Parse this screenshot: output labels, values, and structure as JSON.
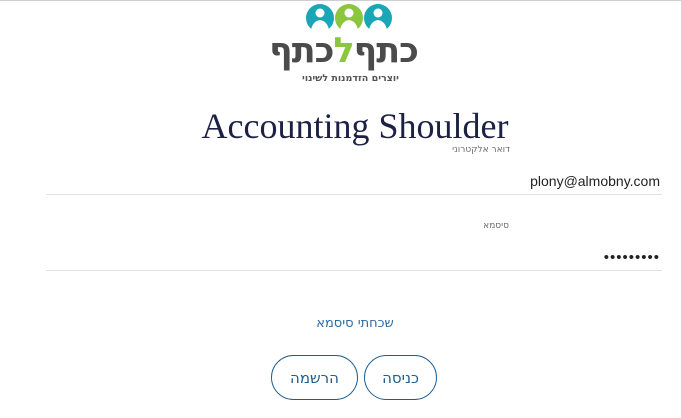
{
  "brand": {
    "logo_text_dark_right": "כתף",
    "logo_text_green": "ל",
    "logo_text_dark_left": "כתף",
    "tagline": "יוצרים הזדמנות לשינוי",
    "colors": {
      "green": "#8cc63f",
      "teal": "#1aa6b7",
      "dark_text": "#4b4b4b"
    }
  },
  "page": {
    "title": "Accounting Shoulder",
    "title_color": "#1c2145"
  },
  "form": {
    "email": {
      "label": "דואר אלקטרוני",
      "value": "plony@almobny.com"
    },
    "password": {
      "label": "סיסמא",
      "value": "•••••••••"
    },
    "forgot_password": "שכחתי סיסמא",
    "login_button": "כניסה",
    "register_button": "הרשמה",
    "accent_color": "#1d5d8f"
  }
}
